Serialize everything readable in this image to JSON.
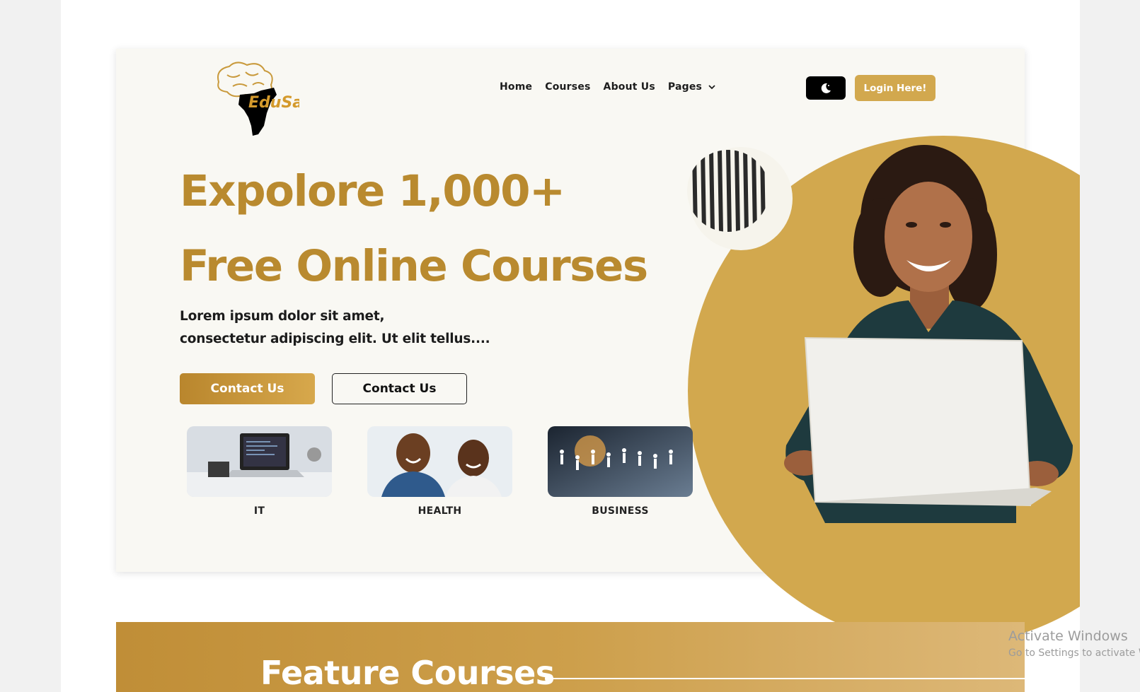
{
  "logo": {
    "text": "EduSafe"
  },
  "nav": {
    "items": [
      "Home",
      "Courses",
      "About Us"
    ],
    "pages_label": "Pages",
    "login_label": "Login Here!"
  },
  "hero": {
    "headline_line1": "Expolore 1,000+",
    "headline_line2": "Free Online Courses",
    "subtext_line1": "Lorem ipsum dolor sit amet,",
    "subtext_line2": "consectetur adipiscing elit. Ut elit tellus....",
    "primary_button": "Contact Us",
    "secondary_button": "Contact Us"
  },
  "categories": [
    {
      "label": "IT"
    },
    {
      "label": "HEALTH"
    },
    {
      "label": "BUSINESS"
    }
  ],
  "feature": {
    "title": "Feature Courses"
  },
  "watermark": {
    "line1": "Activate Windows",
    "line2": "Go to Settings to activate Windows."
  },
  "colors": {
    "accent": "#b98a2f",
    "circle": "#d2a84e",
    "hero_bg": "#f9f8f3",
    "dark": "#000000"
  }
}
